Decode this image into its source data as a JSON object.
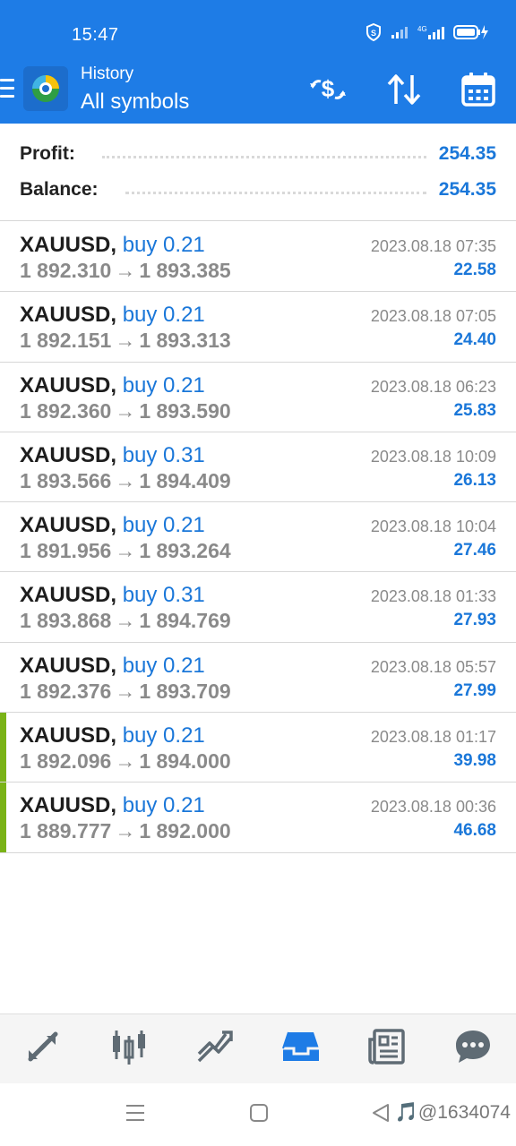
{
  "status_bar": {
    "time": "15:47",
    "network_label": "4G"
  },
  "header": {
    "title": "History",
    "subtitle": "All symbols",
    "actions": [
      {
        "name": "currency-exchange-icon"
      },
      {
        "name": "sort-icon"
      },
      {
        "name": "calendar-icon"
      }
    ]
  },
  "summary": {
    "profit_label": "Profit:",
    "profit_value": "254.35",
    "balance_label": "Balance:",
    "balance_value": "254.35"
  },
  "deals": [
    {
      "symbol": "XAUUSD",
      "type": "buy 0.21",
      "open": "1 892.310",
      "close": "1 893.385",
      "time": "2023.08.18 07:35",
      "profit": "22.58",
      "highlight": false
    },
    {
      "symbol": "XAUUSD",
      "type": "buy 0.21",
      "open": "1 892.151",
      "close": "1 893.313",
      "time": "2023.08.18 07:05",
      "profit": "24.40",
      "highlight": false
    },
    {
      "symbol": "XAUUSD",
      "type": "buy 0.21",
      "open": "1 892.360",
      "close": "1 893.590",
      "time": "2023.08.18 06:23",
      "profit": "25.83",
      "highlight": false
    },
    {
      "symbol": "XAUUSD",
      "type": "buy 0.31",
      "open": "1 893.566",
      "close": "1 894.409",
      "time": "2023.08.18 10:09",
      "profit": "26.13",
      "highlight": false
    },
    {
      "symbol": "XAUUSD",
      "type": "buy 0.21",
      "open": "1 891.956",
      "close": "1 893.264",
      "time": "2023.08.18 10:04",
      "profit": "27.46",
      "highlight": false
    },
    {
      "symbol": "XAUUSD",
      "type": "buy 0.31",
      "open": "1 893.868",
      "close": "1 894.769",
      "time": "2023.08.18 01:33",
      "profit": "27.93",
      "highlight": false
    },
    {
      "symbol": "XAUUSD",
      "type": "buy 0.21",
      "open": "1 892.376",
      "close": "1 893.709",
      "time": "2023.08.18 05:57",
      "profit": "27.99",
      "highlight": false
    },
    {
      "symbol": "XAUUSD",
      "type": "buy 0.21",
      "open": "1 892.096",
      "close": "1 894.000",
      "time": "2023.08.18 01:17",
      "profit": "39.98",
      "highlight": true
    },
    {
      "symbol": "XAUUSD",
      "type": "buy 0.21",
      "open": "1 889.777",
      "close": "1 892.000",
      "time": "2023.08.18 00:36",
      "profit": "46.68",
      "highlight": true
    }
  ],
  "tabs": [
    {
      "name": "quotes-icon",
      "active": false
    },
    {
      "name": "chart-icon",
      "active": false
    },
    {
      "name": "trade-icon",
      "active": false
    },
    {
      "name": "history-icon",
      "active": true
    },
    {
      "name": "news-icon",
      "active": false
    },
    {
      "name": "messages-icon",
      "active": false
    }
  ],
  "colors": {
    "accent": "#1e7ce6",
    "profit": "#1a77d9",
    "marker": "#7ab317",
    "inactive_icon": "#5f6b74"
  },
  "watermark": "🎵@1634074"
}
